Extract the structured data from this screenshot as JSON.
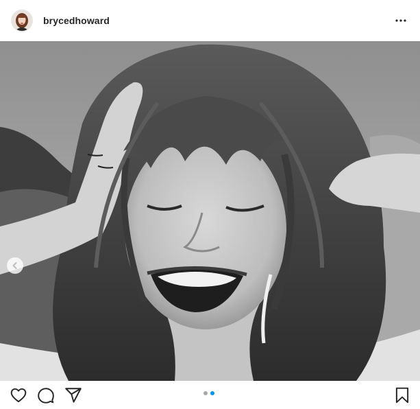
{
  "post": {
    "username": "brycedhoward",
    "photo_alt": "",
    "carousel": {
      "count": 2,
      "active_index": 1
    }
  },
  "icons": {
    "more": "more-options-icon",
    "previous": "chevron-left-icon",
    "like": "heart-icon",
    "comment": "comment-bubble-icon",
    "share": "paper-plane-icon",
    "save": "bookmark-icon"
  },
  "colors": {
    "text": "#262626",
    "active_dot": "#0095f6",
    "inactive_dot": "#a8a8a8"
  }
}
